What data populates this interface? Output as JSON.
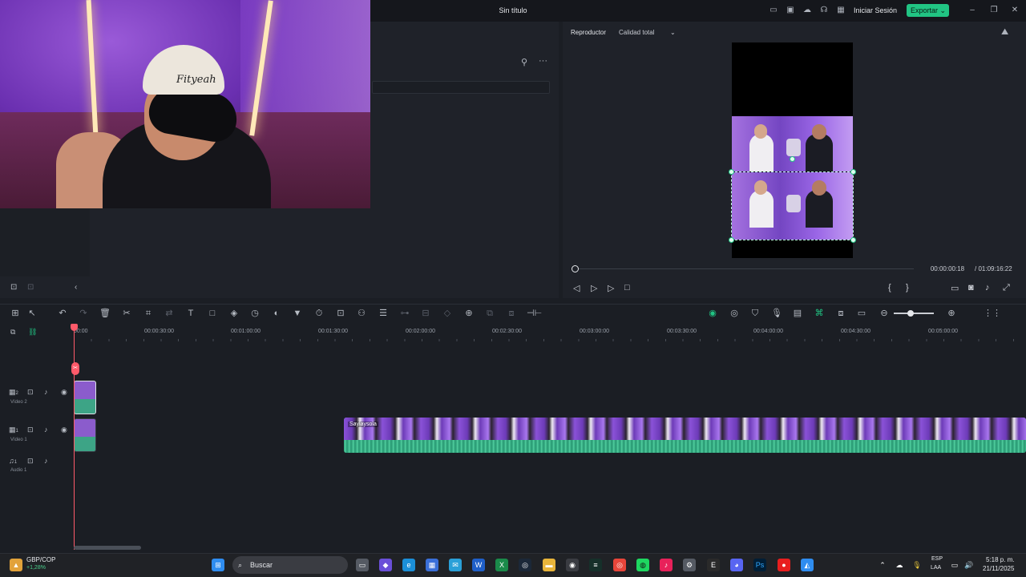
{
  "window": {
    "title": "Sin título",
    "login_label": "Iniciar Sesión",
    "export_label": "Exportar"
  },
  "preview": {
    "tab_label": "Reproductor",
    "quality": "Calidad total",
    "time_current": "00:00:00:18",
    "time_total": "/ 01:09:16:22"
  },
  "timeline": {
    "ruler": [
      "00:00",
      "00:00:30:00",
      "00:01:00:00",
      "00:01:30:00",
      "00:02:00:00",
      "00:02:30:00",
      "00:03:00:00",
      "00:03:30:00",
      "00:04:00:00",
      "00:04:30:00",
      "00:05:00:00"
    ],
    "tracks": [
      {
        "num": "2",
        "name": "Vídeo 2"
      },
      {
        "num": "1",
        "name": "Vídeo 1"
      },
      {
        "num": "1",
        "name": "Audio 1"
      }
    ],
    "clip_label": "Saylaysola",
    "webcam_cap_text": "Fityeah"
  },
  "taskbar": {
    "ticker_name": "GBP/COP",
    "ticker_change": "+1,28%",
    "search_placeholder": "Buscar",
    "lang_1": "ESP",
    "lang_2": "LAA",
    "time": "5:18 p. m.",
    "date": "21/11/2025"
  },
  "colors": {
    "accent": "#21c483",
    "playhead": "#ff5a6a"
  }
}
